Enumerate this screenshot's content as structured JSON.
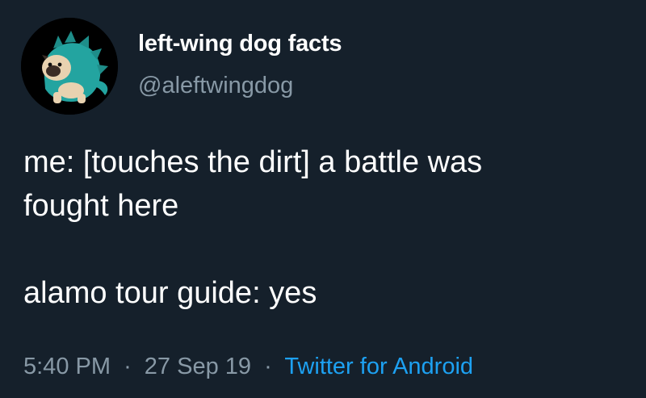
{
  "user": {
    "display_name": "left-wing dog facts",
    "handle": "@aleftwingdog"
  },
  "tweet": {
    "lines": [
      "me: [touches the dirt] a battle was",
      "fought here",
      "alamo tour guide: yes"
    ]
  },
  "meta": {
    "time": "5:40 PM",
    "date": "27 Sep 19",
    "source": "Twitter for Android",
    "separator": "·"
  },
  "colors": {
    "background": "#15202b",
    "text": "#ffffff",
    "secondary_text": "#8899a6",
    "link": "#1da1f2",
    "avatar_costume": "#23a4a0"
  },
  "icons": {
    "avatar": "pug-in-dinosaur-costume-avatar"
  }
}
